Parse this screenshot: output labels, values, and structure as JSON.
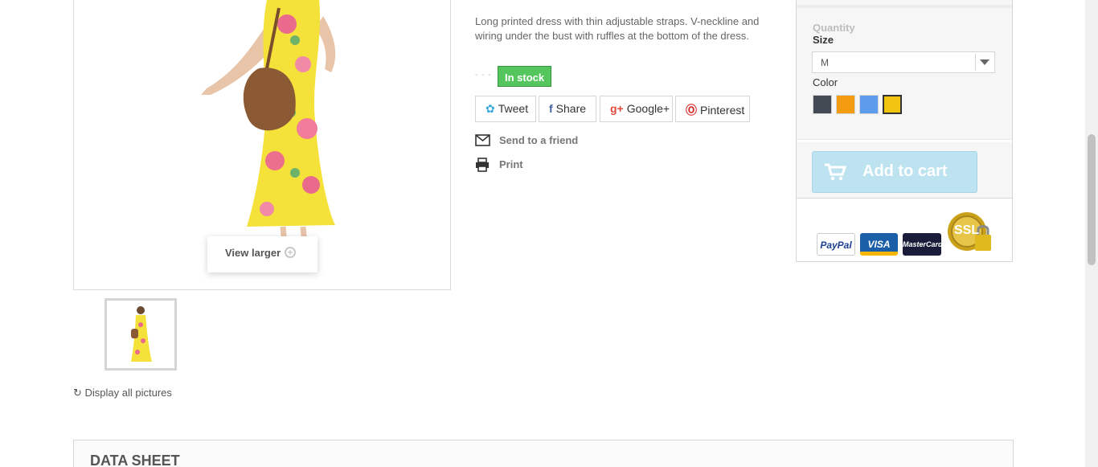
{
  "product": {
    "description": "Long printed dress with thin adjustable straps. V-neckline and wiring under the bust with ruffles at the bottom of the dress.",
    "stock_dash": "- - -",
    "stock_label": "In stock"
  },
  "images": {
    "view_larger": "View larger",
    "display_all": "Display all pictures"
  },
  "social": {
    "tweet": "Tweet",
    "share": "Share",
    "google_plus": "Google+",
    "pinterest": "Pinterest",
    "tweet_icon": "twitter-icon",
    "share_icon": "facebook-icon",
    "google_icon": "google-plus-icon",
    "pinterest_icon": "pinterest-icon"
  },
  "links": {
    "send_friend": "Send to a friend",
    "print": "Print"
  },
  "buy": {
    "quantity_label": "Quantity",
    "size_label": "Size",
    "size_value": "M",
    "color_label": "Color",
    "colors": [
      "#434a54",
      "#f39c11",
      "#5d9cec",
      "#f1c40f"
    ],
    "selected_color_index": 3,
    "add_to_cart": "Add to cart"
  },
  "payments": {
    "paypal": "PayPal",
    "visa": "VISA",
    "mastercard": "MasterCard",
    "ssl": "SSL"
  },
  "sections": {
    "data_sheet": "DATA SHEET"
  },
  "colors": {
    "stock_green": "#55c65e",
    "cart_blue": "#bee3f0",
    "border": "#d6d4d4"
  }
}
